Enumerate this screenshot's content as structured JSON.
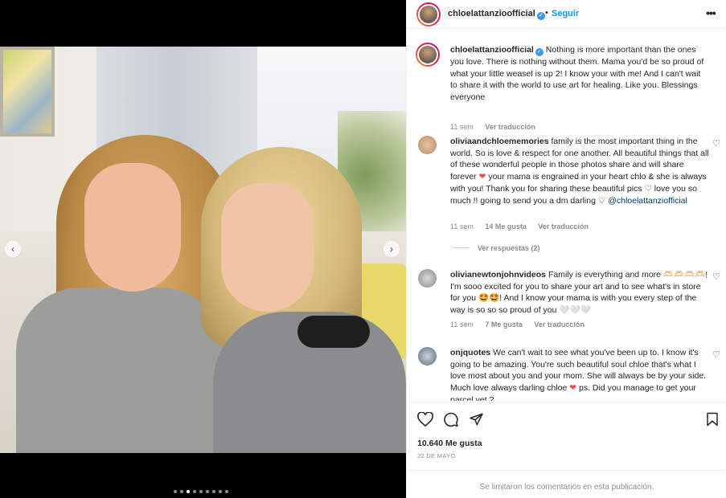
{
  "post": {
    "username": "chloelattanzioofficial",
    "follow_label": "Seguir",
    "separator": "•",
    "more_label": "•••"
  },
  "media": {
    "prev_icon": "chevron-left-icon",
    "next_icon": "chevron-right-icon",
    "slide_count": 9,
    "active_slide": 3
  },
  "comments": [
    {
      "username": "chloelattanzioofficial",
      "verified": true,
      "text": "Nothing is more important than the ones you love. There is nothing without them. Mama you'd be so proud of what your little weasel is up 2! I know your with me! And I can't wait to share it with the world to use art for healing. Like you. Blessings everyone",
      "time": "11 sem",
      "translate": "Ver traducción"
    },
    {
      "username": "oliviaandchloememories",
      "text_1": "family is the most important thing in the world. So is love & respect for one another. All beautiful things that all of these wonderful people in those photos share and will share forever",
      "text_2": "your mama is engrained in your heart chlo & she is always with you! Thank you for sharing these beautiful pics",
      "text_3": "love you so much !! going to send you a dm darling",
      "mention": "@chloelattanziofficial",
      "time": "11 sem",
      "likes": "14 Me gusta",
      "translate": "Ver traducción",
      "replies": "Ver respuestas (2)"
    },
    {
      "username": "olivianewtonjohnvideos",
      "text_1": "Family is everything and more 🫶🏻🫶🏻🫶🏻🫶🏻! I'm sooo excited for you to share your art and to see what's in store for you",
      "text_2": "! And I know your mama is with you every step of the way is so so so proud of you 🤍🤍🤍",
      "time": "11 sem",
      "likes": "7 Me gusta",
      "translate": "Ver traducción"
    },
    {
      "username": "onjquotes",
      "text_1": "We can't wait to see what you've been up to. I know it's going to be amazing. You're such beautiful soul chloe that's what I love most about you and your mom. She will always be by your side. Much love always darling chloe",
      "text_2": "ps. Did you manage to get your parcel yet ?"
    }
  ],
  "actions": {
    "likes": "10.640 Me gusta",
    "date": "22 DE MAYO",
    "comments_limited": "Se limitaron los comentarios en esta publicación."
  },
  "colors": {
    "link": "#0095f6",
    "verified": "#3897f0",
    "heart": "#ed4956",
    "muted": "#8e8e8e"
  }
}
